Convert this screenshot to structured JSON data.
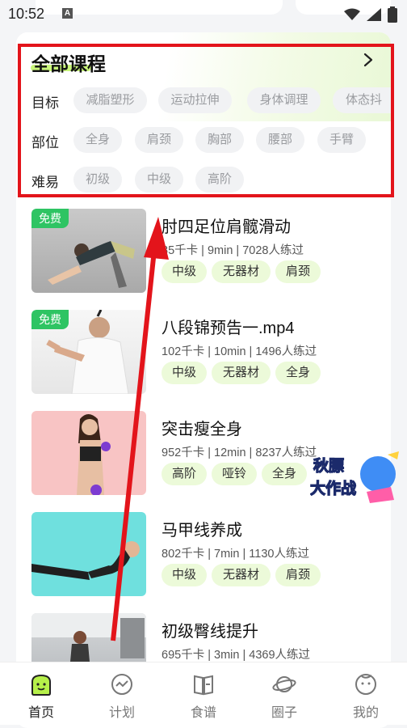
{
  "status": {
    "time": "10:52",
    "a_icon_text": "A"
  },
  "filters": {
    "title": "全部课程",
    "rows": [
      {
        "label": "目标",
        "chips": [
          "减脂塑形",
          "运动拉伸",
          "身体调理",
          "体态抖"
        ]
      },
      {
        "label": "部位",
        "chips": [
          "全身",
          "肩颈",
          "胸部",
          "腰部",
          "手臂"
        ]
      },
      {
        "label": "难易",
        "chips": [
          "初级",
          "中级",
          "高阶"
        ]
      }
    ]
  },
  "courses": [
    {
      "free_badge": "免费",
      "name": "肘四足位肩髋滑动",
      "stats": "85千卡 | 9min  |  7028人练过",
      "tags": [
        "中级",
        "无器材",
        "肩颈"
      ]
    },
    {
      "free_badge": "免费",
      "name": "八段锦预告一.mp4",
      "stats": "102千卡 | 10min  |  1496人练过",
      "tags": [
        "中级",
        "无器材",
        "全身"
      ]
    },
    {
      "free_badge": "",
      "name": "突击瘦全身",
      "stats": "952千卡 | 12min  |  8237人练过",
      "tags": [
        "高阶",
        "哑铃",
        "全身"
      ]
    },
    {
      "free_badge": "",
      "name": "马甲线养成",
      "stats": "802千卡 | 7min  |  1130人练过",
      "tags": [
        "中级",
        "无器材",
        "肩颈"
      ]
    },
    {
      "free_badge": "",
      "name": "初级臀线提升",
      "stats": "695千卡 | 3min  |  4369人练过",
      "tags": []
    }
  ],
  "sticker": {
    "line1": "秋膘",
    "line2": "大作战"
  },
  "tabs": [
    {
      "label": "首页",
      "icon": "home-face-icon",
      "active": true
    },
    {
      "label": "计划",
      "icon": "plan-chart-icon",
      "active": false
    },
    {
      "label": "食谱",
      "icon": "recipe-book-icon",
      "active": false
    },
    {
      "label": "圈子",
      "icon": "planet-icon",
      "active": false
    },
    {
      "label": "我的",
      "icon": "profile-face-icon",
      "active": false
    }
  ],
  "colors": {
    "accent_green": "#c9f57a",
    "tag_bg": "#ecfad9",
    "free_green": "#2ec463",
    "annotation_red": "#e3141b"
  }
}
